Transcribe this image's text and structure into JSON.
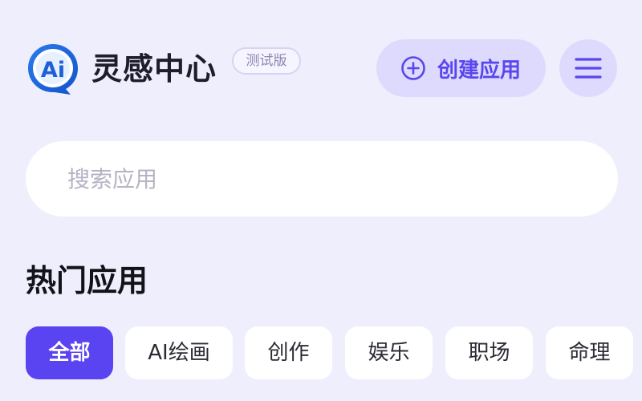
{
  "header": {
    "logo_icon": "ai-chat-bubble-logo",
    "logo_text": "Ai",
    "title": "灵感中心",
    "badge": "测试版",
    "create_button": {
      "label": "创建应用",
      "icon": "plus-circle-icon"
    },
    "menu_icon": "hamburger-menu-icon"
  },
  "search": {
    "placeholder": "搜索应用",
    "value": ""
  },
  "section": {
    "title": "热门应用"
  },
  "categories": {
    "selected": "全部",
    "items": [
      "全部",
      "AI绘画",
      "创作",
      "娱乐",
      "职场",
      "命理"
    ]
  },
  "colors": {
    "background": "#efeefd",
    "accent": "#5a43f0",
    "accent_light": "#dedafd",
    "chip_background": "#ffffff"
  }
}
